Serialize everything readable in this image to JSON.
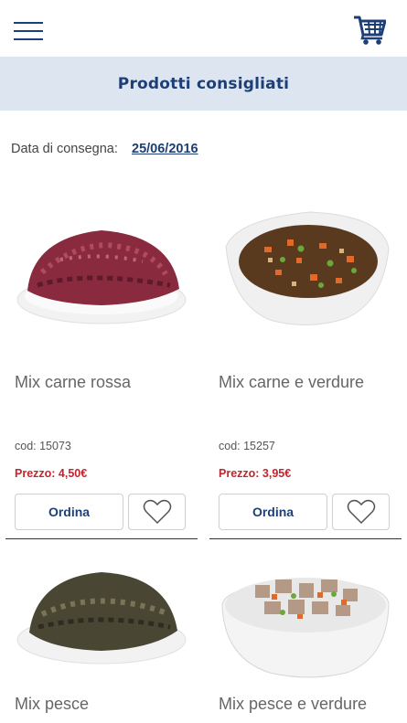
{
  "header": {
    "menu_icon": "hamburger-menu-icon",
    "cart_icon": "shopping-cart-icon"
  },
  "section": {
    "title": "Prodotti consigliati"
  },
  "delivery": {
    "label": "Data di consegna:",
    "date": "25/06/2016"
  },
  "products": [
    {
      "name": "Mix carne rossa",
      "code": "cod: 15073",
      "price": "Prezzo: 4,50€",
      "order_label": "Ordina"
    },
    {
      "name": "Mix carne e verdure",
      "code": "cod: 15257",
      "price": "Prezzo: 3,95€",
      "order_label": "Ordina"
    },
    {
      "name": "Mix pesce"
    },
    {
      "name": "Mix pesce e verdure"
    }
  ],
  "colors": {
    "brand_blue": "#1d3f78",
    "header_bg": "#dde6f0",
    "price_red": "#c0262d"
  }
}
